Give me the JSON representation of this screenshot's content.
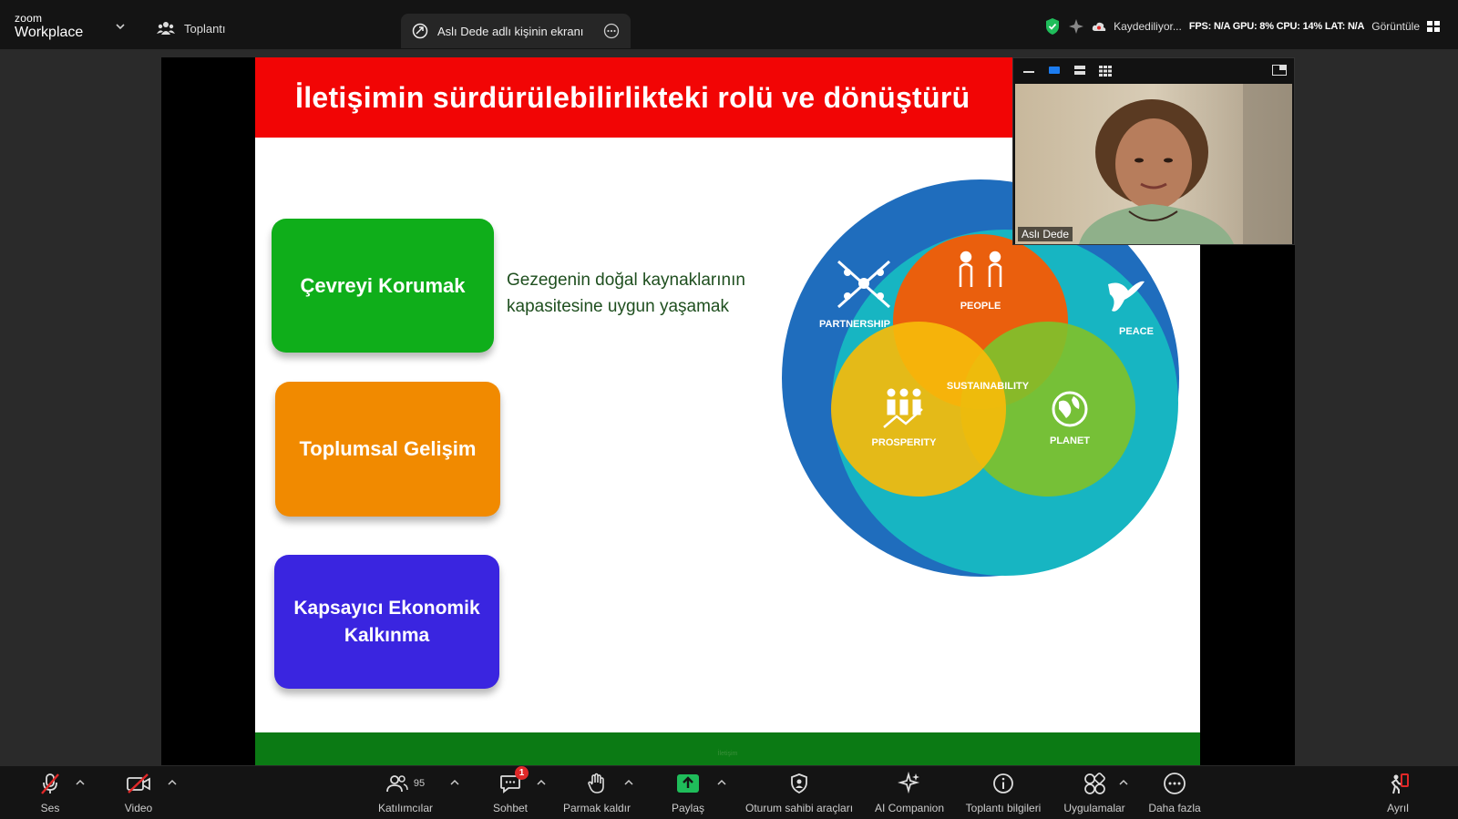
{
  "app": {
    "brand_small": "zoom",
    "brand_large": "Workplace",
    "meeting_tab": "Toplantı",
    "share_tab": "Aslı Dede adlı kişinin ekranı",
    "status": {
      "recording": "Kaydediliyor...",
      "perf": "FPS: N/A  GPU: 8%  CPU: 14%  LAT: N/A",
      "view": "Görüntüle"
    }
  },
  "slide": {
    "title": "İletişimin sürdürülebilirlikteki rolü ve dönüştürü",
    "boxes": [
      {
        "label": "Çevreyi Korumak",
        "color": "#0fae1a"
      },
      {
        "label": "Toplumsal Gelişim",
        "color": "#f18a00"
      },
      {
        "label": "Kapsayıcı Ekonomik Kalkınma",
        "color": "#3a25e0"
      }
    ],
    "description_line1": "Gezegenin doğal kaynaklarının",
    "description_line2": "kapasitesine uygun yaşamak",
    "footer_text": "İletişim",
    "diagram": {
      "center": "SUSTAINABILITY",
      "partnership": "PARTNERSHIP",
      "people": "PEOPLE",
      "peace": "PEACE",
      "prosperity": "PROSPERITY",
      "planet": "PLANET"
    }
  },
  "webcam": {
    "participant_name": "Aslı Dede"
  },
  "toolbar": {
    "audio": "Ses",
    "video": "Video",
    "participants": "Katılımcılar",
    "participants_count": "95",
    "chat": "Sohbet",
    "chat_badge": "1",
    "raise_hand": "Parmak kaldır",
    "share": "Paylaş",
    "host_tools": "Oturum sahibi araçları",
    "ai_companion": "AI Companion",
    "meeting_info": "Toplantı bilgileri",
    "apps": "Uygulamalar",
    "more": "Daha fazla",
    "leave": "Ayrıl"
  },
  "colors": {
    "title_red": "#f20505",
    "footer_green": "#0b7a14",
    "share_green": "#1fbd5a",
    "badge_red": "#e02828"
  }
}
